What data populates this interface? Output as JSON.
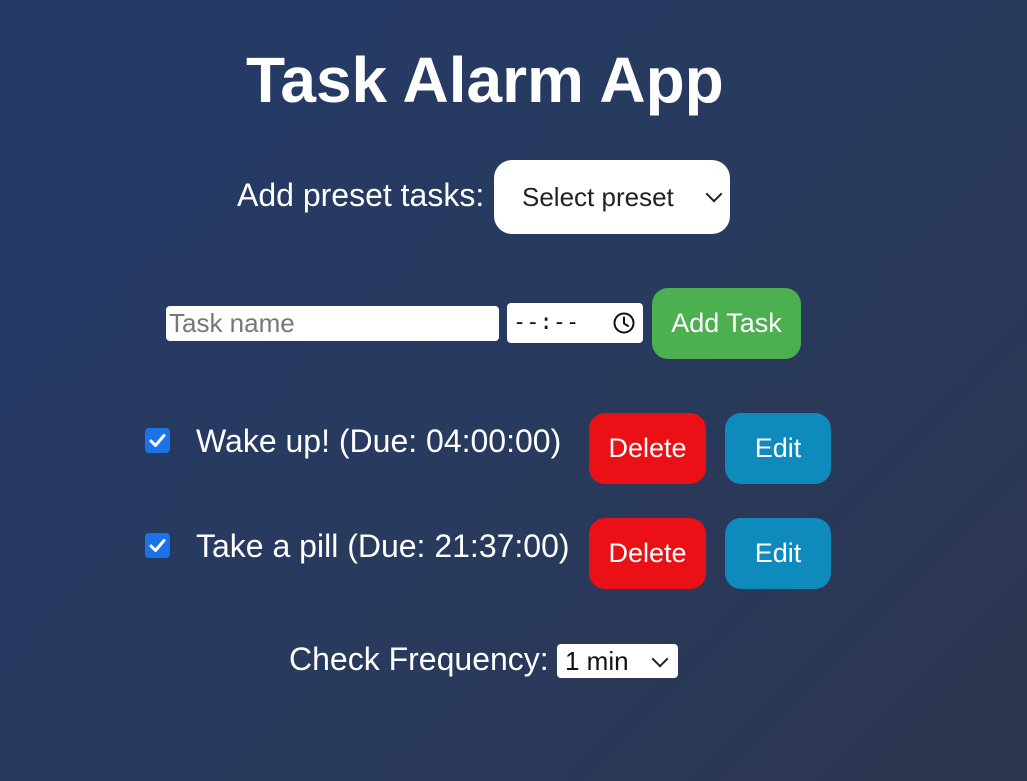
{
  "app": {
    "title": "Task Alarm App"
  },
  "preset": {
    "label": "Add preset tasks:",
    "selected": "Select preset"
  },
  "new_task": {
    "name_placeholder": "Task name",
    "time_placeholder": "--:--",
    "add_label": "Add Task"
  },
  "tasks": [
    {
      "text": "Wake up! (Due: 04:00:00)",
      "checked": true,
      "delete_label": "Delete",
      "edit_label": "Edit"
    },
    {
      "text": "Take a pill (Due: 21:37:00)",
      "checked": true,
      "delete_label": "Delete",
      "edit_label": "Edit"
    }
  ],
  "frequency": {
    "label": "Check Frequency:",
    "selected": "1 min"
  },
  "colors": {
    "add_button": "#4caf50",
    "delete_button": "#ea1016",
    "edit_button": "#0e8abd",
    "checkbox": "#1a73e8"
  },
  "icons": {
    "time_picker": "clock-icon",
    "dropdown": "chevron-down-icon",
    "checked": "checkmark-icon"
  }
}
